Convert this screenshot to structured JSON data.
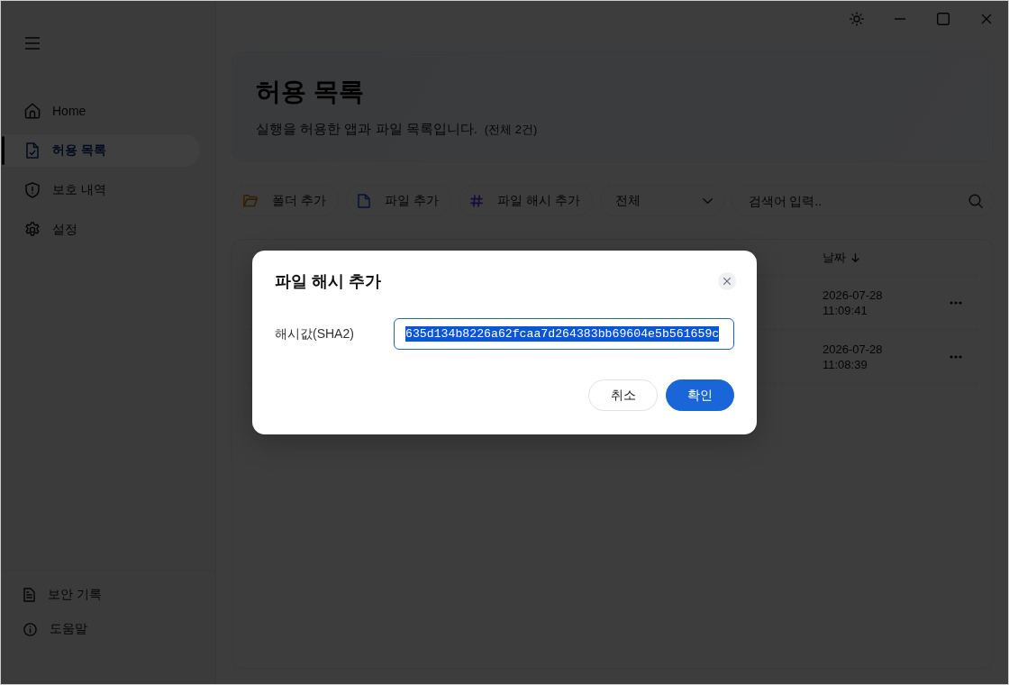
{
  "sidebar": {
    "items": [
      {
        "label": "Home",
        "selected": false
      },
      {
        "label": "허용 목록",
        "selected": true
      },
      {
        "label": "보호 내역",
        "selected": false
      },
      {
        "label": "설정",
        "selected": false
      }
    ],
    "footer_items": [
      {
        "label": "보안 기록"
      },
      {
        "label": "도움말"
      }
    ]
  },
  "page_header": {
    "title": "허용 목록",
    "subtitle": "실행을 허용한 앱과 파일 목록입니다.",
    "count": "(전체 2건)"
  },
  "toolbar": {
    "buttons": [
      {
        "label": "폴더 추가"
      },
      {
        "label": "파일 추가"
      },
      {
        "label": "파일 해시 추가"
      }
    ],
    "filter": {
      "value": "전체"
    },
    "search": {
      "placeholder": "검색어 입력.."
    }
  },
  "table": {
    "columns": [
      {
        "label": "날짜",
        "sort_descending": true
      }
    ],
    "rows": [
      {
        "date": "2026-07-28",
        "time": "11:09:41"
      },
      {
        "date": "2026-07-28",
        "time": "11:08:39"
      }
    ]
  },
  "dialog": {
    "title": "파일 해시 추가",
    "field": {
      "label": "해시값(SHA2)",
      "value": "635d134b8226a62fcaa7d264383bb69604e5b561659c",
      "focused": true,
      "text_selected": true
    },
    "buttons": [
      {
        "label": "취소",
        "kind": "secondary"
      },
      {
        "label": "확인",
        "kind": "primary"
      }
    ]
  }
}
